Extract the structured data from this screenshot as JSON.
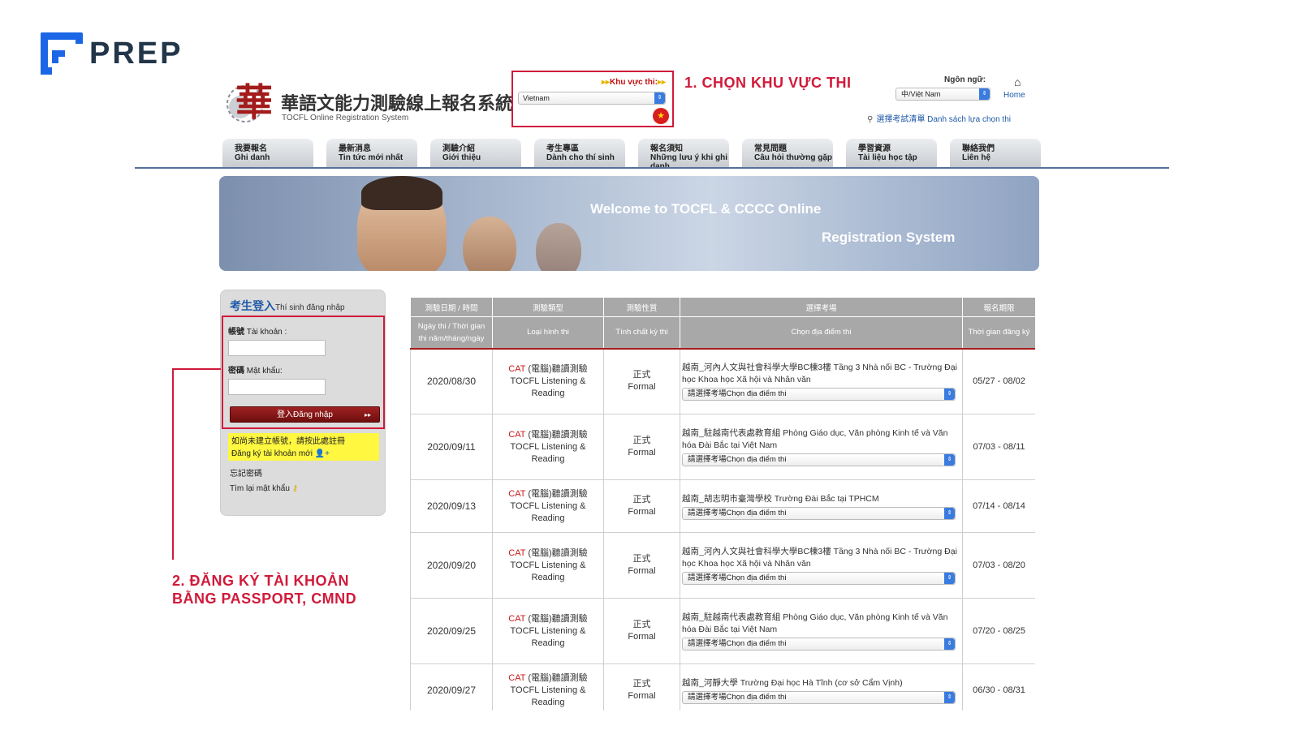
{
  "brand": {
    "name": "PREP",
    "color": "#1a66e6"
  },
  "site": {
    "title_zh": "華語文能力測驗線上報名系統",
    "subtitle": "TOCFL Online Registration System",
    "logo_glyph": "華"
  },
  "region": {
    "label": "Khu vực thi:",
    "selected": "Vietnam",
    "flag_icon": "vietnam-flag-icon"
  },
  "annotations": {
    "step1": "1. CHỌN KHU VỰC THI",
    "step2_line1": "2. ĐĂNG KÝ TÀI KHOẢN",
    "step2_line2": "BẰNG PASSPORT, CMND",
    "color": "#d01a3a"
  },
  "language": {
    "label": "Ngôn ngữ:",
    "selected": "中/Việt Nam"
  },
  "home_link": "Home",
  "exam_list_link": "選擇考試清單 Danh sách lựa chọn thi",
  "nav": [
    {
      "zh": "我要報名",
      "vi": "Ghi danh"
    },
    {
      "zh": "最新消息",
      "vi": "Tin tức mới nhất"
    },
    {
      "zh": "測驗介紹",
      "vi": "Giới thiệu"
    },
    {
      "zh": "考生專區",
      "vi": "Dành cho thí sinh"
    },
    {
      "zh": "報名須知",
      "vi": "Những lưu ý khi ghi danh"
    },
    {
      "zh": "常見問題",
      "vi": "Câu hỏi thường gặp"
    },
    {
      "zh": "學習資源",
      "vi": "Tài liệu học tập"
    },
    {
      "zh": "聯絡我們",
      "vi": "Liên hệ"
    }
  ],
  "banner": {
    "line1": "Welcome to TOCFL & CCCC Online",
    "line2": "Registration System"
  },
  "login": {
    "title_zh": "考生登入",
    "title_vi": "Thí sinh đăng nhập",
    "account_zh": "帳號",
    "account_vi": "Tài khoản :",
    "password_zh": "密碼",
    "password_vi": "Mật khẩu:",
    "button": "登入Đăng nhập",
    "register_zh": "如尚未建立帳號，請按此處註冊",
    "register_vi": "Đăng ký tài khoản mới",
    "forgot_zh": "忘記密碼",
    "forgot_vi": "Tìm lại mật khẩu"
  },
  "table": {
    "headers": [
      {
        "zh": "測驗日期 / 時間",
        "vi": "Ngày thi / Thời gian thi năm/tháng/ngày"
      },
      {
        "zh": "測驗類型",
        "vi": "Loại hình thi"
      },
      {
        "zh": "測驗性質",
        "vi": "Tính chất kỳ thi"
      },
      {
        "zh": "選擇考場",
        "vi": "Chọn địa điểm thi"
      },
      {
        "zh": "報名期限",
        "vi": "Thời gian đăng ký"
      }
    ],
    "select_placeholder": "請選擇考場Chọn địa điểm thi",
    "rows": [
      {
        "date": "2020/08/30",
        "cat": "CAT",
        "type_zh": "(電腦)聽讀測驗",
        "type_en": "TOCFL Listening & Reading",
        "nature_zh": "正式",
        "nature_en": "Formal",
        "location": "越南_河內人文與社會科學大學BC棟3樓 Tầng 3 Nhà nối BC - Trường Đại học Khoa học Xã hội và Nhân văn",
        "period": "05/27 - 08/02"
      },
      {
        "date": "2020/09/11",
        "cat": "CAT",
        "type_zh": "(電腦)聽讀測驗",
        "type_en": "TOCFL Listening & Reading",
        "nature_zh": "正式",
        "nature_en": "Formal",
        "location": "越南_駐越南代表處教育組 Phòng Giáo dục, Văn phòng Kinh tế và Văn hóa Đài Bắc tại Việt Nam",
        "period": "07/03 - 08/11"
      },
      {
        "date": "2020/09/13",
        "cat": "CAT",
        "type_zh": "(電腦)聽讀測驗",
        "type_en": "TOCFL Listening & Reading",
        "nature_zh": "正式",
        "nature_en": "Formal",
        "location": "越南_胡志明市臺灣學校 Trường Đài Bắc tại TPHCM",
        "period": "07/14 - 08/14"
      },
      {
        "date": "2020/09/20",
        "cat": "CAT",
        "type_zh": "(電腦)聽讀測驗",
        "type_en": "TOCFL Listening & Reading",
        "nature_zh": "正式",
        "nature_en": "Formal",
        "location": "越南_河內人文與社會科學大學BC棟3樓 Tầng 3 Nhà nối BC - Trường Đại học Khoa học Xã hội và Nhân văn",
        "period": "07/03 - 08/20"
      },
      {
        "date": "2020/09/25",
        "cat": "CAT",
        "type_zh": "(電腦)聽讀測驗",
        "type_en": "TOCFL Listening & Reading",
        "nature_zh": "正式",
        "nature_en": "Formal",
        "location": "越南_駐越南代表處教育組 Phòng Giáo dục, Văn phòng Kinh tế và Văn hóa Đài Bắc tại Việt Nam",
        "period": "07/20 - 08/25"
      },
      {
        "date": "2020/09/27",
        "cat": "CAT",
        "type_zh": "(電腦)聽讀測驗",
        "type_en": "TOCFL Listening & Reading",
        "nature_zh": "正式",
        "nature_en": "Formal",
        "location": "越南_河靜大學 Trường Đại học Hà Tĩnh (cơ sở Cẩm Vịnh)",
        "period": "06/30 - 08/31"
      }
    ]
  }
}
